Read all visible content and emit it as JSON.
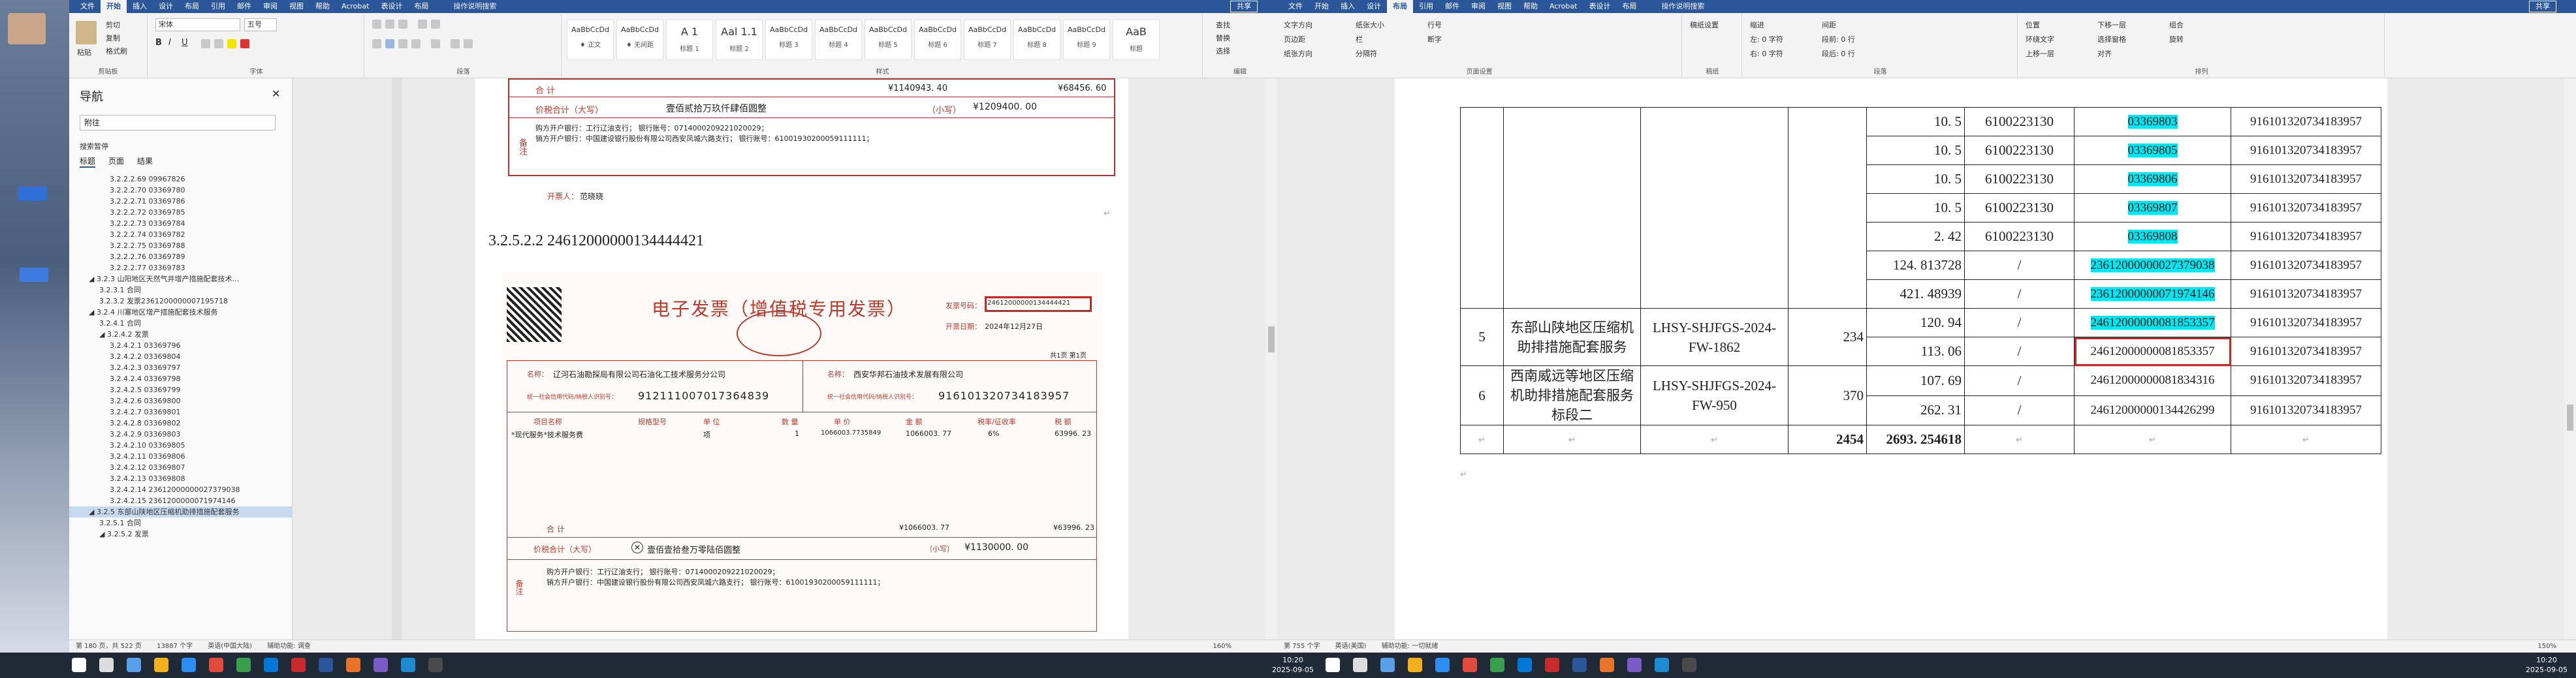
{
  "left_window": {
    "tabs": [
      "文件",
      "开始",
      "插入",
      "设计",
      "布局",
      "引用",
      "邮件",
      "审阅",
      "视图",
      "帮助",
      "Acrobat",
      "表设计",
      "布局"
    ],
    "tell_me": "操作说明搜索",
    "share": "共享",
    "ribbon": {
      "clipboard": {
        "label": "剪贴板",
        "paste": "粘贴",
        "cut": "剪切",
        "copy": "复制",
        "format_painter": "格式刷"
      },
      "font": {
        "label": "字体",
        "name": "宋体",
        "size": "五号"
      },
      "paragraph": {
        "label": "段落"
      },
      "styles": {
        "label": "样式",
        "items": [
          {
            "preview": "AaBbCcDd",
            "name": "♦ 正文"
          },
          {
            "preview": "AaBbCcDd",
            "name": "♦ 无间距"
          },
          {
            "preview": "A 1",
            "name": "标题 1"
          },
          {
            "preview": "Aal 1.1",
            "name": "标题 2"
          },
          {
            "preview": "AaBbCcDd",
            "name": "标题 3"
          },
          {
            "preview": "AaBbCcDd",
            "name": "标题 4"
          },
          {
            "preview": "AaBbCcDd",
            "name": "标题 5"
          },
          {
            "preview": "AaBbCcDd",
            "name": "标题 6"
          },
          {
            "preview": "AaBbCcDd",
            "name": "标题 7"
          },
          {
            "preview": "AaBbCcDd",
            "name": "标题 8"
          },
          {
            "preview": "AaBbCcDd",
            "name": "标题 9"
          },
          {
            "preview": "AaB",
            "name": "标题"
          }
        ]
      },
      "editing": {
        "label": "编辑",
        "find": "查找",
        "replace": "替换",
        "select": "选择"
      }
    },
    "nav": {
      "title": "导航",
      "search_value": "附往",
      "search_results_label": "搜索暂停",
      "tabs": [
        "标题",
        "页面",
        "结果"
      ],
      "items": [
        {
          "text": "3.2.2.2.69 09967826",
          "indent": 2
        },
        {
          "text": "3.2.2.2.70 03369780",
          "indent": 2
        },
        {
          "text": "3.2.2.2.71 03369786",
          "indent": 2
        },
        {
          "text": "3.2.2.2.72 03369785",
          "indent": 2
        },
        {
          "text": "3.2.2.2.73 03369784",
          "indent": 2
        },
        {
          "text": "3.2.2.2.74 03369782",
          "indent": 2
        },
        {
          "text": "3.2.2.2.75 03369788",
          "indent": 2
        },
        {
          "text": "3.2.2.2.76 03369789",
          "indent": 2
        },
        {
          "text": "3.2.2.2.77 03369783",
          "indent": 2
        },
        {
          "text": "◢ 3.2.3 山阳地区天然气井增产措施配套技术...",
          "indent": 0
        },
        {
          "text": "3.2.3.1 合同",
          "indent": 1
        },
        {
          "text": "3.2.3.2 发票2361200000007195718",
          "indent": 1
        },
        {
          "text": "◢ 3.2.4 川塞地区增产措施配套技术服务",
          "indent": 0
        },
        {
          "text": "3.2.4.1 合同",
          "indent": 1
        },
        {
          "text": "◢ 3.2.4.2 发票",
          "indent": 1
        },
        {
          "text": "3.2.4.2.1 03369796",
          "indent": 2
        },
        {
          "text": "3.2.4.2.2 03369804",
          "indent": 2
        },
        {
          "text": "3.2.4.2.3 03369797",
          "indent": 2
        },
        {
          "text": "3.2.4.2.4 03369798",
          "indent": 2
        },
        {
          "text": "3.2.4.2.5 03369799",
          "indent": 2
        },
        {
          "text": "3.2.4.2.6 03369800",
          "indent": 2
        },
        {
          "text": "3.2.4.2.7 03369801",
          "indent": 2
        },
        {
          "text": "3.2.4.2.8 03369802",
          "indent": 2
        },
        {
          "text": "3.2.4.2.9 03369803",
          "indent": 2
        },
        {
          "text": "3.2.4.2.10 03369805",
          "indent": 2
        },
        {
          "text": "3.2.4.2.11 03369806",
          "indent": 2
        },
        {
          "text": "3.2.4.2.12 03369807",
          "indent": 2
        },
        {
          "text": "3.2.4.2.13 03369808",
          "indent": 2
        },
        {
          "text": "3.2.4.2.14 2361200000002737903​8",
          "indent": 2
        },
        {
          "text": "3.2.4.2.15 2361200000071974146",
          "indent": 2
        },
        {
          "text": "◢ 3.2.5 东部山陕地区压缩机助排措施配套服务",
          "indent": 0,
          "selected": true
        },
        {
          "text": "3.2.5.1 合同",
          "indent": 1
        },
        {
          "text": "◢ 3.2.5.2 发票",
          "indent": 1
        }
      ]
    },
    "doc": {
      "top_invoice": {
        "row1_left": "合    计",
        "row1_amount": "¥1140943. 40",
        "row1_tax": "¥68456. 60",
        "total_label": "价税合计（大写）",
        "total_words": "壹佰贰拾万玖仟肆佰圆整",
        "total_small_label": "（小写）",
        "total_small": "¥1209400. 00",
        "remark_label": "备注",
        "remark_line1": "购方开户银行：工行辽油支行；    银行账号：0714000209221020029；",
        "remark_line2": "销方开户银行：中国建设银行股份有限公司西安凤城六路支行；    银行账号：61001930200059111111；",
        "issuer_label": "开票人：",
        "issuer": "范晓晓"
      },
      "heading": "3.2.5.2.2 24612000000134444421",
      "invoice": {
        "title": "电子发票（增值税专用发票）",
        "number_label": "发票号码：",
        "number": "24612000000134444421",
        "date_label": "开票日期：",
        "date": "2024年12月27日",
        "page": "共1页 第1页",
        "buyer_name_label": "名称：",
        "buyer_name": "辽河石油勘探局有限公司石油化工技术服务分公司",
        "buyer_tax_label": "统一社会信用代码/纳税人识别号：",
        "buyer_tax": "912111007017364839",
        "seller_name": "西安华邦石油技术发展有限公司",
        "seller_tax": "916101320734183957",
        "cols": [
          "项目名称",
          "规格型号",
          "单 位",
          "数 量",
          "单 价",
          "金 额",
          "税率/征收率",
          "税 额"
        ],
        "item": "*现代服务*技术服务费",
        "unit": "项",
        "qty": "1",
        "price": "1066003.7735849",
        "amount": "1066003. 77",
        "rate": "6%",
        "tax": "63996. 23",
        "sum_label": "合    计",
        "sum_amount": "¥1066003. 77",
        "sum_tax": "¥63996. 23",
        "total_label": "价税合计（大写）",
        "total_words": "壹佰壹拾叁万零陆佰圆整",
        "total_small_label": "（小写）",
        "total_small": "¥1130000. 00",
        "remark_label": "备注",
        "remark_line1": "购方开户银行：工行辽油支行；    银行账号：0714000209221020029；",
        "remark_line2": "销方开户银行：中国建设银行股份有限公司西安凤城六路支行；    银行账号：61001930200059111111；"
      }
    },
    "status": [
      "第 180 页，共 522 页",
      "13887 个字",
      "英语(中国大陆)",
      "辅助功能: 调查"
    ],
    "zoom": "160%"
  },
  "right_window": {
    "tabs": [
      "文件",
      "开始",
      "插入",
      "设计",
      "布局",
      "引用",
      "邮件",
      "审阅",
      "视图",
      "帮助",
      "Acrobat",
      "表设计",
      "布局"
    ],
    "tell_me": "操作说明搜索",
    "share": "共享",
    "ribbon_groups": [
      {
        "label": "页面设置",
        "items": [
          "文字方向",
          "页边距",
          "纸张方向",
          "纸张大小",
          "栏",
          "分隔符",
          "行号",
          "断字"
        ]
      },
      {
        "label": "稿纸",
        "items": [
          "稿纸设置"
        ]
      },
      {
        "label": "段落",
        "items": [
          "缩进",
          "左: 0 字符",
          "右: 0 字符",
          "间距",
          "段前: 0 行",
          "段后: 0 行"
        ]
      },
      {
        "label": "排列",
        "items": [
          "位置",
          "环绕文字",
          "上移一层",
          "下移一层",
          "选择窗格",
          "对齐",
          "组合",
          "旋转"
        ]
      }
    ],
    "table": {
      "rows": [
        {
          "qty": "10. 5",
          "code": "6100223130",
          "inv": "03369803",
          "hl": "full",
          "tax": "916101320734183957"
        },
        {
          "qty": "10. 5",
          "code": "6100223130",
          "inv": "03369805",
          "hl": "part",
          "tax": "916101320734183957"
        },
        {
          "qty": "10. 5",
          "code": "6100223130",
          "inv": "03369806",
          "hl": "part",
          "tax": "916101320734183957"
        },
        {
          "qty": "10. 5",
          "code": "6100223130",
          "inv": "03369807",
          "hl": "part",
          "tax": "916101320734183957"
        },
        {
          "qty": "2. 42",
          "code": "6100223130",
          "inv": "03369808",
          "hl": "part",
          "tax": "916101320734183957"
        },
        {
          "qty": "124. 813728",
          "code": "/",
          "inv": "23612000000027379038",
          "hl": "mid",
          "tax": "916101320734183957"
        },
        {
          "qty": "421. 48939",
          "code": "/",
          "inv": "23612000000071974146",
          "hl": "mid",
          "tax": "916101320734183957"
        },
        {
          "qty": "120. 94",
          "code": "/",
          "inv": "24612000000081853357",
          "hl": "full",
          "tax": "916101320734183957"
        },
        {
          "qty": "113. 06",
          "code": "/",
          "inv": "24612000000081853357",
          "hl": "none",
          "boxed": true,
          "tax": "916101320734183957"
        },
        {
          "qty": "107. 69",
          "code": "/",
          "inv": "24612000000081834316",
          "hl": "none",
          "tax": "916101320734183957"
        },
        {
          "qty": "262. 31",
          "code": "/",
          "inv": "24612000000134426299",
          "hl": "none",
          "tax": "916101320734183957"
        }
      ],
      "group5": {
        "no": "5",
        "name": "东部山陕地区压缩机助排措施配套服务",
        "contract": "LHSY-SHJFGS-2024-FW-1862",
        "amount": "234"
      },
      "group6": {
        "no": "6",
        "name": "西南威远等地区压缩机助排措施配套服务标段二",
        "contract": "LHSY-SHJFGS-2024-FW-950",
        "amount": "370"
      },
      "total": {
        "amount": "2454",
        "qty": "2693. 254618"
      }
    },
    "status": [
      "第 755 个字",
      "英语(美国)",
      "辅助功能: 一切就绪"
    ],
    "zoom": "150%"
  },
  "taskbar": {
    "clock_left": {
      "time": "10:20",
      "date": "2025-09-05"
    },
    "clock_right": {
      "time": "10:20",
      "date": "2025-09-05"
    }
  }
}
